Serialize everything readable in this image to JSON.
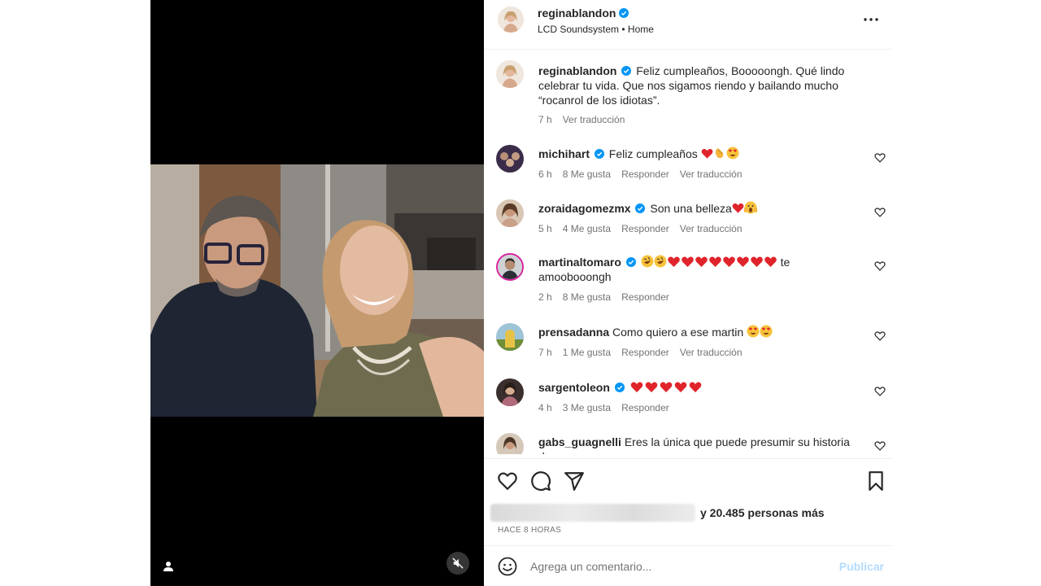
{
  "post": {
    "author": "reginablandon",
    "audio": "LCD Soundsystem • Home",
    "more_icon": "more-horizontal-icon"
  },
  "caption": {
    "user": "reginablandon",
    "text": "Feliz cumpleaños, Booooongh. Qué lindo celebrar tu vida. Que nos sigamos riendo y bailando mucho “rocanrol de los idiotas”.",
    "time": "7 h",
    "translate": "Ver traducción"
  },
  "comments": [
    {
      "user": "michihart",
      "verified": true,
      "text": "Feliz cumpleaños",
      "emojis": [
        "heart",
        "clap",
        "heart-eyes"
      ],
      "time": "6 h",
      "likes": "8 Me gusta",
      "reply": "Responder",
      "translate": "Ver traducción"
    },
    {
      "user": "zoraidagomezmx",
      "verified": true,
      "text": "Son una belleza",
      "emojis": [
        "heart",
        "scream"
      ],
      "time": "5 h",
      "likes": "4 Me gusta",
      "reply": "Responder",
      "translate": "Ver traducción"
    },
    {
      "user": "martinaltomaro",
      "verified": true,
      "text": "te amoobooongh",
      "emojis": [
        "rofl",
        "rofl",
        "heart",
        "heart",
        "heart",
        "heart",
        "heart",
        "heart",
        "heart",
        "heart"
      ],
      "time": "2 h",
      "likes": "8 Me gusta",
      "reply": "Responder"
    },
    {
      "user": "prensadanna",
      "verified": false,
      "text": "Como quiero a ese martin",
      "emojis": [
        "heart-eyes",
        "heart-eyes"
      ],
      "time": "7 h",
      "likes": "1 Me gusta",
      "reply": "Responder",
      "translate": "Ver traducción"
    },
    {
      "user": "sargentoleon",
      "verified": true,
      "text": "",
      "emojis": [
        "heart",
        "heart",
        "heart",
        "heart",
        "heart"
      ],
      "time": "4 h",
      "likes": "3 Me gusta",
      "reply": "Responder"
    },
    {
      "user": "gabs_guagnelli",
      "verified": false,
      "text": "Eres la única que puede presumir su historia de"
    }
  ],
  "likes_summary": {
    "more": "y 20.485 personas más"
  },
  "timestamp": "Hace 8 horas",
  "composer": {
    "placeholder": "Agrega un comentario...",
    "publish": "Publicar"
  },
  "colors": {
    "verified": "#0095f6",
    "heart_emoji": "#e0242b",
    "muted_text": "#737373",
    "publish_disabled": "#b3dbff"
  }
}
